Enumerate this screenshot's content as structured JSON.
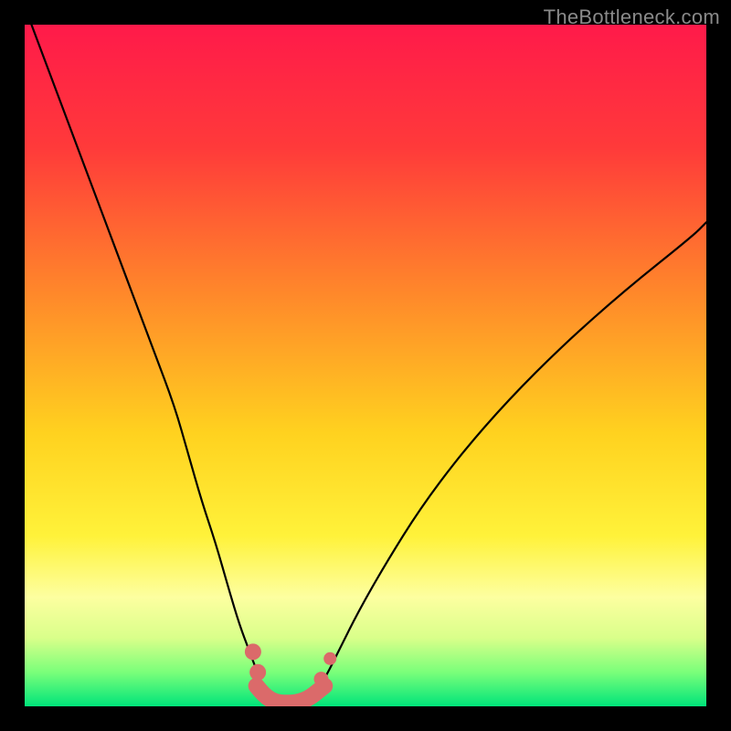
{
  "watermark": "TheBottleneck.com",
  "chart_data": {
    "type": "line",
    "title": "",
    "xlabel": "",
    "ylabel": "",
    "xlim": [
      0,
      100
    ],
    "ylim": [
      0,
      100
    ],
    "gradient_stops": [
      {
        "offset": 0.0,
        "color": "#ff1a4a"
      },
      {
        "offset": 0.18,
        "color": "#ff3a3a"
      },
      {
        "offset": 0.4,
        "color": "#ff8a2a"
      },
      {
        "offset": 0.6,
        "color": "#ffd21f"
      },
      {
        "offset": 0.75,
        "color": "#fff23a"
      },
      {
        "offset": 0.84,
        "color": "#fdffa0"
      },
      {
        "offset": 0.9,
        "color": "#d9ff8a"
      },
      {
        "offset": 0.95,
        "color": "#7aff7a"
      },
      {
        "offset": 1.0,
        "color": "#00e47a"
      }
    ],
    "series": [
      {
        "name": "left-curve",
        "x": [
          1,
          4,
          7,
          10,
          13,
          16,
          19,
          22,
          24,
          26,
          28,
          30,
          31.5,
          33,
          34.5,
          35.5
        ],
        "y": [
          100,
          92,
          84,
          76,
          68,
          60,
          52,
          44,
          37,
          30,
          24,
          17,
          12,
          8,
          4,
          2
        ],
        "stroke": "#000000",
        "stroke_width": 2.2
      },
      {
        "name": "right-curve",
        "x": [
          42.5,
          44,
          46,
          49,
          53,
          58,
          64,
          71,
          79,
          88,
          98,
          100
        ],
        "y": [
          2,
          4,
          8,
          14,
          21,
          29,
          37,
          45,
          53,
          61,
          69,
          71
        ],
        "stroke": "#000000",
        "stroke_width": 2.2
      },
      {
        "name": "bottom-valley",
        "x": [
          34,
          35,
          36,
          37,
          38,
          39,
          40,
          41,
          42,
          43,
          44
        ],
        "y": [
          3,
          1.8,
          1,
          0.6,
          0.5,
          0.5,
          0.6,
          0.9,
          1.4,
          2.2,
          3
        ],
        "stroke": "#db6a6a",
        "stroke_width": 18
      }
    ],
    "markers": [
      {
        "name": "left-marker-upper",
        "x": 33.5,
        "y": 8,
        "r": 9,
        "fill": "#db6a6a"
      },
      {
        "name": "left-marker-lower",
        "x": 34.2,
        "y": 5,
        "r": 9,
        "fill": "#db6a6a"
      },
      {
        "name": "right-marker-lower",
        "x": 43.5,
        "y": 4,
        "r": 8,
        "fill": "#db6a6a"
      },
      {
        "name": "right-marker-upper",
        "x": 44.8,
        "y": 7,
        "r": 7,
        "fill": "#db6a6a"
      }
    ]
  }
}
